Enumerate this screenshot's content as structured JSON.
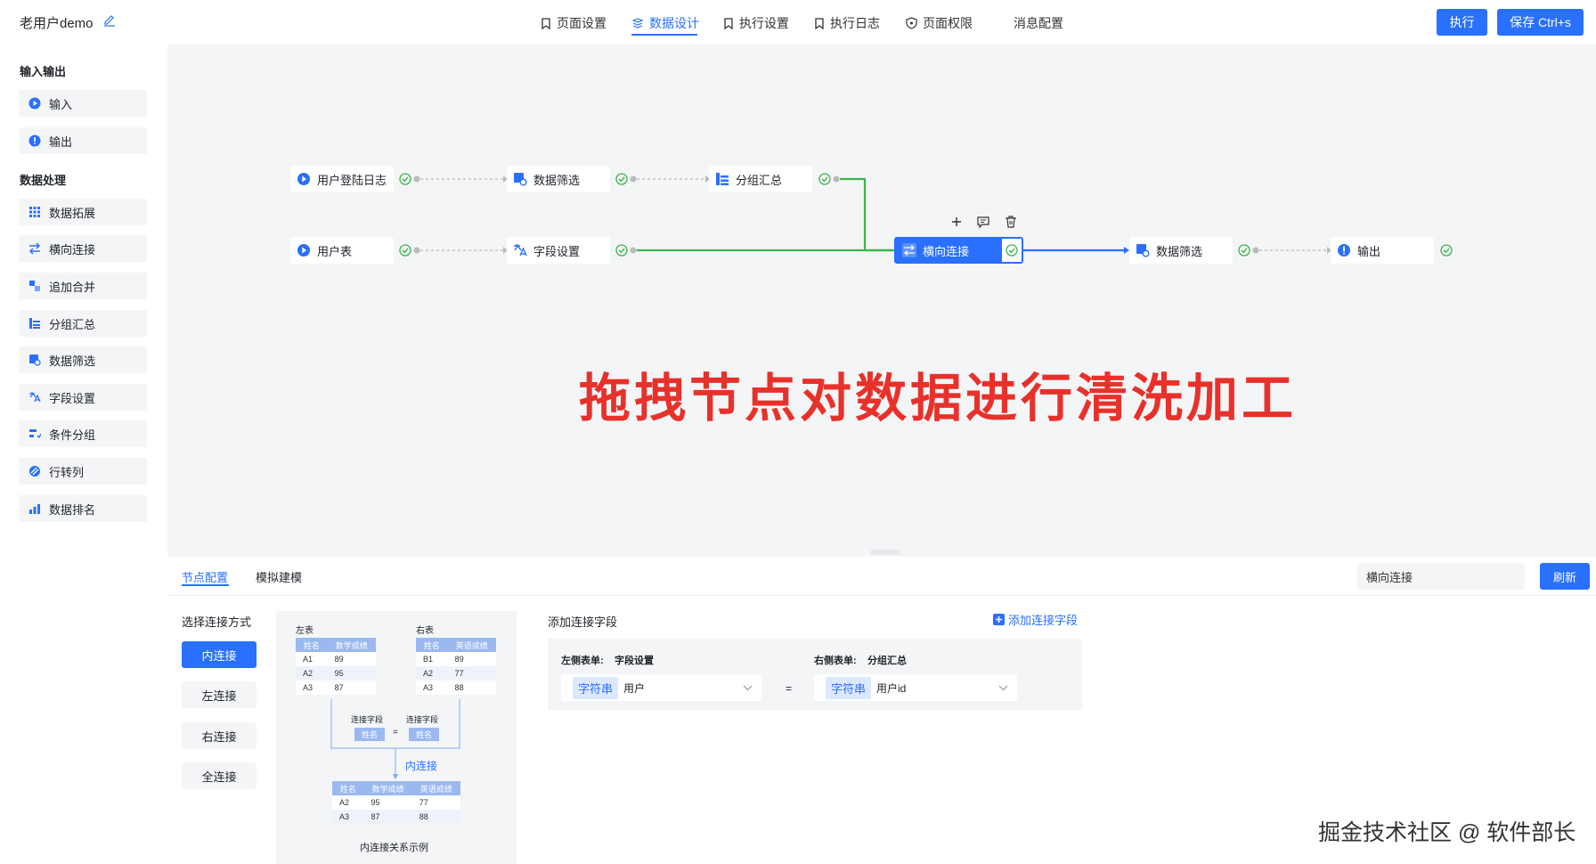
{
  "header": {
    "project_title": "老用户demo",
    "tabs": [
      {
        "label": "页面设置",
        "icon": "bookmark-icon"
      },
      {
        "label": "数据设计",
        "icon": "data-design-icon",
        "active": true
      },
      {
        "label": "执行设置",
        "icon": "bookmark-icon"
      },
      {
        "label": "执行日志",
        "icon": "bookmark-icon"
      },
      {
        "label": "页面权限",
        "icon": "shield-icon"
      },
      {
        "label": "消息配置",
        "icon": ""
      }
    ],
    "run_label": "执行",
    "save_label": "保存 Ctrl+s"
  },
  "sidebar": {
    "groups": [
      {
        "title": "输入输出",
        "items": [
          {
            "label": "输入",
            "icon": "play-circle-icon"
          },
          {
            "label": "输出",
            "icon": "info-circle-icon"
          }
        ]
      },
      {
        "title": "数据处理",
        "items": [
          {
            "label": "数据拓展",
            "icon": "grid-icon"
          },
          {
            "label": "横向连接",
            "icon": "horizontal-join-icon"
          },
          {
            "label": "追加合并",
            "icon": "append-merge-icon"
          },
          {
            "label": "分组汇总",
            "icon": "group-summary-icon"
          },
          {
            "label": "数据筛选",
            "icon": "data-filter-icon"
          },
          {
            "label": "字段设置",
            "icon": "field-setting-icon"
          },
          {
            "label": "条件分组",
            "icon": "condition-group-icon"
          },
          {
            "label": "行转列",
            "icon": "row-to-column-icon"
          },
          {
            "label": "数据排名",
            "icon": "ranking-icon"
          }
        ]
      }
    ]
  },
  "canvas": {
    "nodes": {
      "login_log": "用户登陆日志",
      "filter1": "数据筛选",
      "group_sum": "分组汇总",
      "user_table": "用户表",
      "field_set": "字段设置",
      "h_join": "横向连接",
      "filter2": "数据筛选",
      "output": "输出"
    },
    "overlay_text": "拖拽节点对数据进行清洗加工"
  },
  "bottom": {
    "tabs": [
      "节点配置",
      "模拟建模"
    ],
    "node_name": "横向连接",
    "refresh_label": "刷新",
    "join_title": "选择连接方式",
    "join_types": [
      "内连接",
      "左连接",
      "右连接",
      "全连接"
    ],
    "diagram": {
      "left_title": "左表",
      "right_title": "右表",
      "left_headers": [
        "姓名",
        "数学成绩"
      ],
      "left_rows": [
        [
          "A1",
          "89"
        ],
        [
          "A2",
          "95"
        ],
        [
          "A3",
          "87"
        ]
      ],
      "right_headers": [
        "姓名",
        "英语成绩"
      ],
      "right_rows": [
        [
          "B1",
          "89"
        ],
        [
          "A2",
          "77"
        ],
        [
          "A3",
          "88"
        ]
      ],
      "join_field_label": "连接字段",
      "join_field_value": "姓名",
      "equals": "=",
      "join_name": "内连接",
      "result_headers": [
        "姓名",
        "数学成绩",
        "英语成绩"
      ],
      "result_rows": [
        [
          "A2",
          "95",
          "77"
        ],
        [
          "A3",
          "87",
          "88"
        ]
      ],
      "caption": "内连接关系示例"
    },
    "field_title": "添加连接字段",
    "add_field_label": "添加连接字段",
    "left_table_label": "左侧表单:",
    "left_table_name": "字段设置",
    "right_table_label": "右侧表单:",
    "right_table_name": "分组汇总",
    "left_field_type": "字符串",
    "left_field_value": "用户",
    "equals": "=",
    "right_field_type": "字符串",
    "right_field_value": "用户id"
  },
  "watermark": "掘金技术社区 @ 软件部长",
  "colors": {
    "accent": "#2970ff",
    "success": "#3bb54a",
    "overlay": "#e8312a"
  }
}
